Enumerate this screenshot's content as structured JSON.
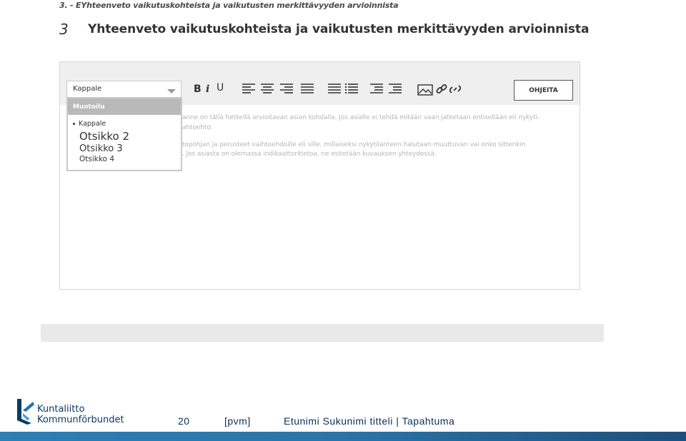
{
  "crumb": "3. - EYhteenveto vaikutuskohteista ja vaikutusten merkittävyyden arvioinnista",
  "section": {
    "number": "3",
    "title": "Yhteenveto vaikutuskohteista ja vaikutusten merkittävyyden arvioinnista"
  },
  "editor": {
    "format_select": {
      "value": "Kappale",
      "menu_header": "Muotoilu",
      "options": [
        "Kappale",
        "Otsikko 2",
        "Otsikko 3",
        "Otsikko 4"
      ]
    },
    "toolbar": {
      "bold_label": "B",
      "italic_label": "i",
      "underline_label": "U",
      "help_label": "OHJEITA"
    },
    "content": {
      "p1_line1": "anne on tällä hetkellä arvioitavan asian kohdalla. Jos asialle ei tehdä mitään vaan jatketaan entisellään eli nykyti-",
      "p1_line2": "ahtoehto.",
      "p2_line1": "topohjan ja perusteet vaihtoehdoille eli sille, millaiseksi nykytilanteen halutaan muuttuvan vai onko sittenkin",
      "p2_line2": ". Jos asiasta on olemassa indikaattoritietoa, ne esitetään kuvauksen yhteydessä."
    }
  },
  "footer": {
    "logo_line1": "Kuntaliitto",
    "logo_line2": "Kommunförbundet",
    "page": "20",
    "date": "[pvm]",
    "author": "Etunimi Sukunimi titteli | Tapahtuma"
  },
  "colors": {
    "brand_blue": "#0b3a66",
    "toolbar_bg": "#efefef",
    "menu_header_bg": "#b9b9b9"
  }
}
